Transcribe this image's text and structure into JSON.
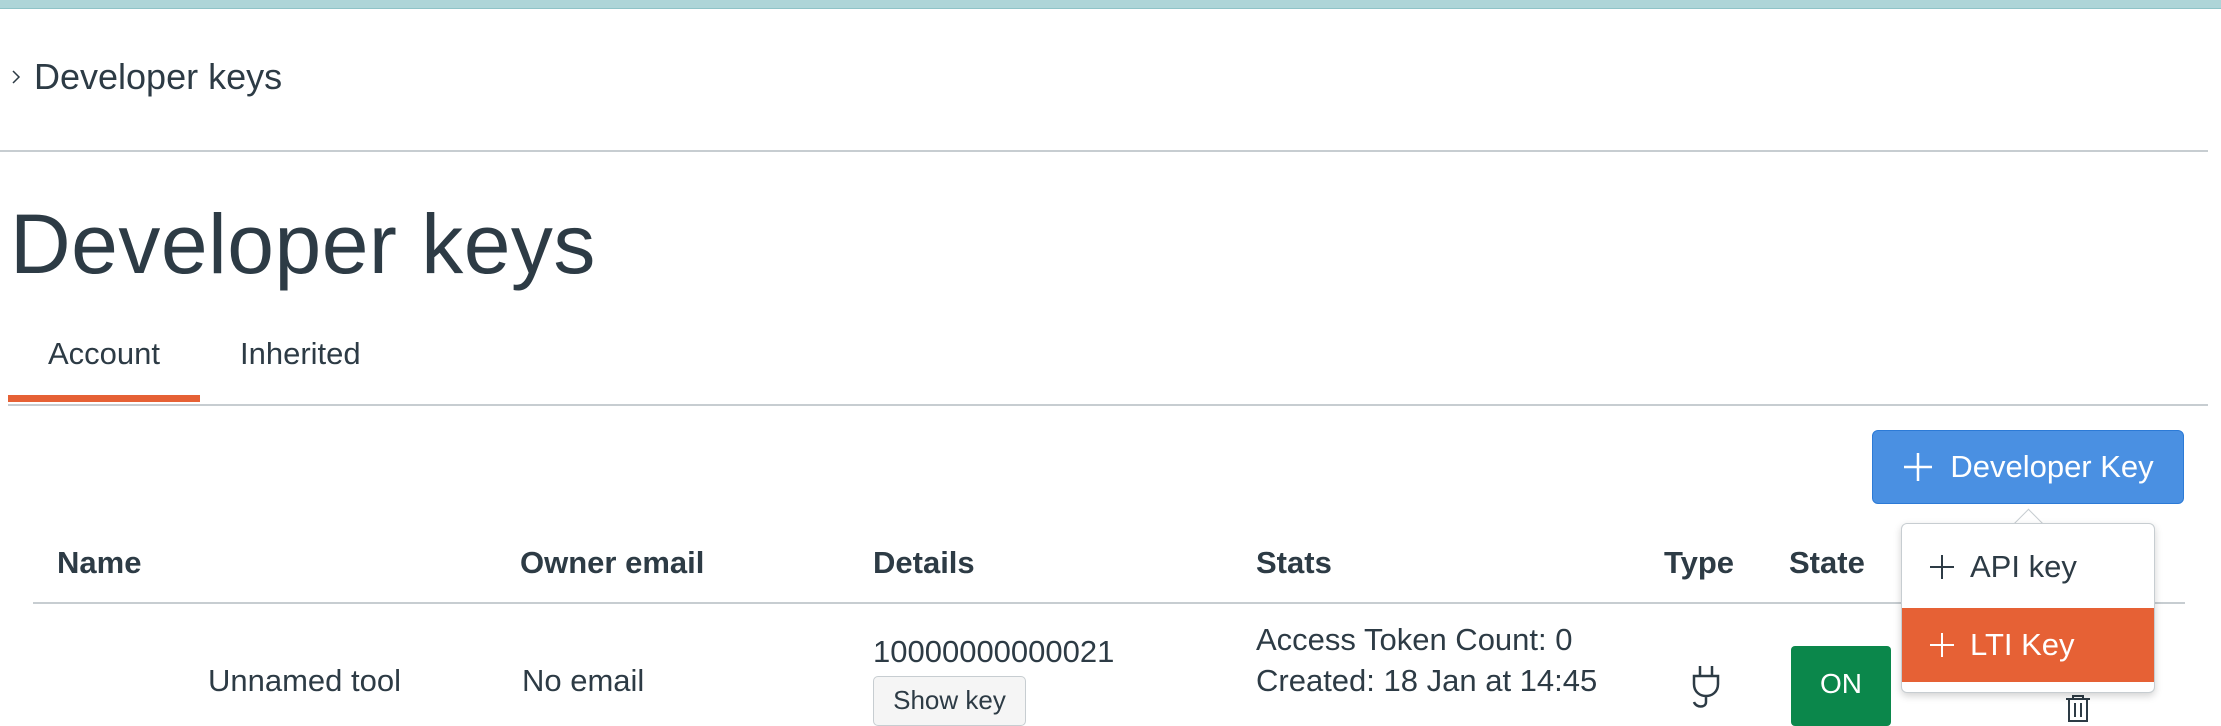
{
  "breadcrumb": {
    "label": "Developer keys"
  },
  "page": {
    "title": "Developer keys"
  },
  "tabs": [
    {
      "label": "Account",
      "active": true
    },
    {
      "label": "Inherited",
      "active": false
    }
  ],
  "add_button": {
    "label": "Developer Key",
    "icon": "plus-icon",
    "color": "#4a90e2"
  },
  "add_menu": {
    "items": [
      {
        "label": "API key",
        "icon": "plus-icon",
        "highlighted": false
      },
      {
        "label": "LTI Key",
        "icon": "plus-icon",
        "highlighted": true,
        "color": "#e66135"
      }
    ]
  },
  "table": {
    "headers": [
      "Name",
      "Owner email",
      "Details",
      "Stats",
      "Type",
      "State"
    ],
    "rows": [
      {
        "name": "Unnamed tool",
        "owner_email": "No email",
        "details_id": "10000000000021",
        "show_key_label": "Show key",
        "stats": [
          "Access Token Count: 0",
          "Created: 18 Jan at 14:45"
        ],
        "type_icon": "plug-icon",
        "state_label": "ON",
        "state_color": "#0b874b",
        "action_icon": "trash-icon"
      }
    ]
  },
  "colors": {
    "accent": "#e66135",
    "primary": "#4a90e2",
    "text": "#2d3b45",
    "success": "#0b874b"
  }
}
